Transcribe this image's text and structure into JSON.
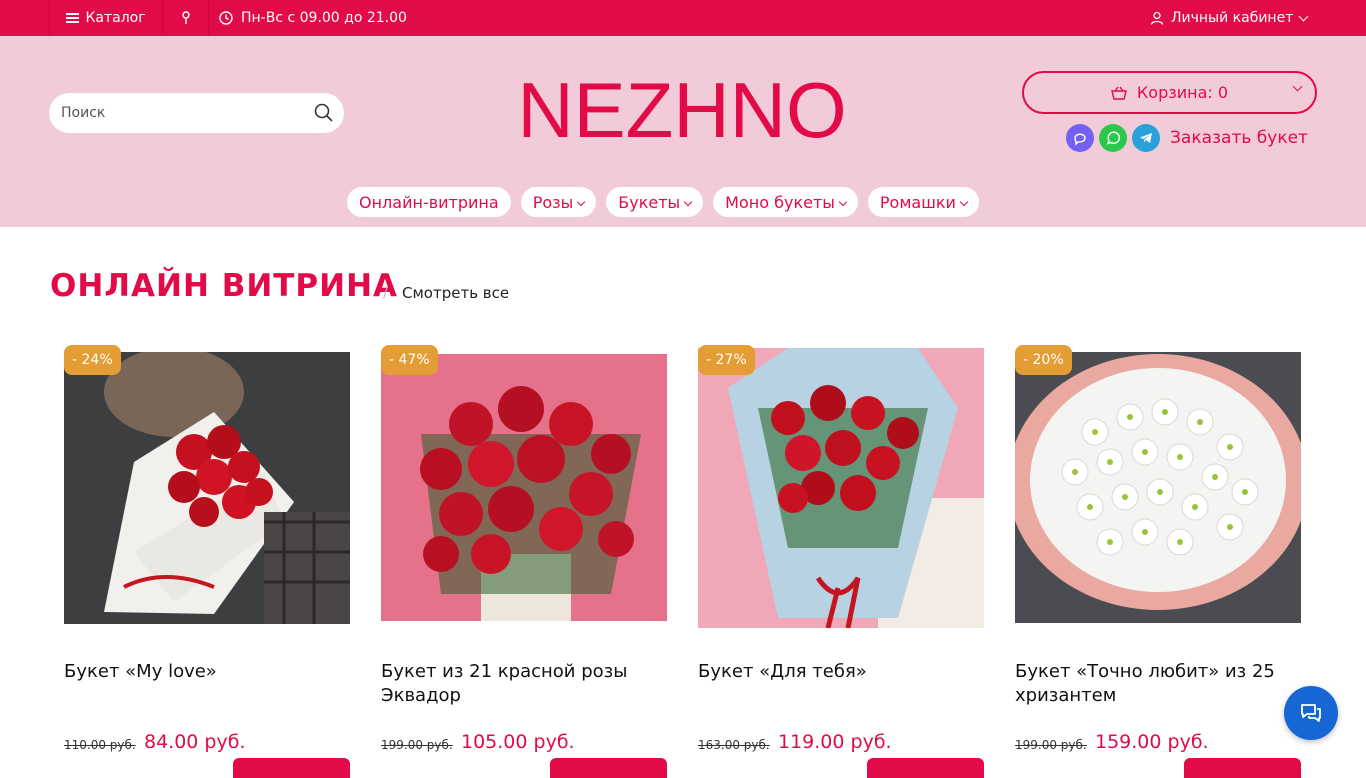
{
  "colors": {
    "accent": "#e30a48",
    "header_bg": "#f2cbd8",
    "badge": "#e39d34",
    "chat": "#1766d6"
  },
  "topbar": {
    "catalog_label": "Каталог",
    "hours_label": "Пн-Вс с 09.00 до 21.00",
    "account_label": "Личный кабинет"
  },
  "header": {
    "search_placeholder": "Поиск",
    "logo_text": "NEZHNO",
    "cart_label": "Корзина: 0",
    "order_label": "Заказать букет"
  },
  "menu": [
    {
      "label": "Онлайн-витрина",
      "dropdown": false
    },
    {
      "label": "Розы",
      "dropdown": true
    },
    {
      "label": "Букеты",
      "dropdown": true
    },
    {
      "label": "Моно букеты",
      "dropdown": true
    },
    {
      "label": "Ромашки",
      "dropdown": true
    }
  ],
  "section": {
    "title": "ОНЛАЙН ВИТРИНА",
    "separator": "/",
    "see_all": "Смотреть все"
  },
  "products": [
    {
      "badge": "- 24%",
      "name": "Букет «My love»",
      "old_price": "110.00 руб.",
      "price": "84.00 руб."
    },
    {
      "badge": "- 47%",
      "name": "Букет из 21 красной розы Эквадор",
      "old_price": "199.00 руб.",
      "price": "105.00 руб."
    },
    {
      "badge": "- 27%",
      "name": "Букет «Для тебя»",
      "old_price": "163.00 руб.",
      "price": "119.00 руб."
    },
    {
      "badge": "- 20%",
      "name": "Букет «Точно любит» из 25 хризантем",
      "old_price": "199.00 руб.",
      "price": "159.00 руб."
    }
  ]
}
